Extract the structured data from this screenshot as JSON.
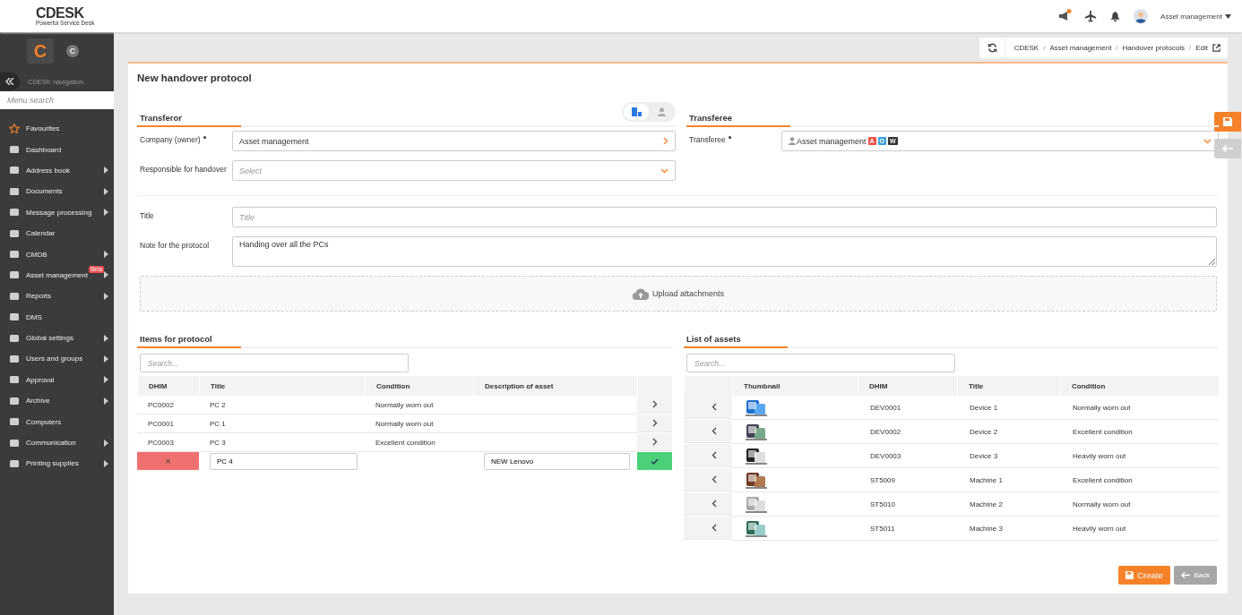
{
  "header": {
    "logo": "CDESK",
    "tagline": "Powerful Service Desk",
    "user": "Asset management"
  },
  "sidebar": {
    "logo_letter": "C",
    "avatar_letter": "C",
    "nav_title": "CDESK navigation",
    "search_placeholder": "Menu search",
    "items": [
      {
        "label": "Favourites",
        "expandable": false
      },
      {
        "label": "Dashboard",
        "expandable": false
      },
      {
        "label": "Address book",
        "expandable": true
      },
      {
        "label": "Documents",
        "expandable": true
      },
      {
        "label": "Message processing",
        "expandable": true
      },
      {
        "label": "Calendar",
        "expandable": false
      },
      {
        "label": "CMDB",
        "expandable": true
      },
      {
        "label": "Asset management",
        "expandable": true,
        "badge": "Beta"
      },
      {
        "label": "Reports",
        "expandable": true
      },
      {
        "label": "DMS",
        "expandable": false
      },
      {
        "label": "Global settings",
        "expandable": true
      },
      {
        "label": "Users and groups",
        "expandable": true
      },
      {
        "label": "Approval",
        "expandable": true
      },
      {
        "label": "Archive",
        "expandable": true
      },
      {
        "label": "Computers",
        "expandable": false
      },
      {
        "label": "Communication",
        "expandable": true
      },
      {
        "label": "Printing supplies",
        "expandable": true
      }
    ]
  },
  "breadcrumbs": [
    {
      "label": "CDESK",
      "separator": "/"
    },
    {
      "label": "Asset management",
      "separator": "/"
    },
    {
      "label": "Handover protocols",
      "separator": "/"
    },
    {
      "label": "Edit"
    }
  ],
  "form": {
    "title": "New handover protocol",
    "transferor": {
      "heading": "Transferor",
      "owner_toggle": [
        {
          "selected": true
        },
        {
          "selected": false
        }
      ],
      "company": {
        "label": "Company (owner)",
        "required": true,
        "value": "Asset management"
      },
      "responsible": {
        "label": "Responsible for handover",
        "required": false,
        "placeholder": "Select"
      }
    },
    "transferee": {
      "heading": "Transferee",
      "label": "Transferee",
      "required": true,
      "value": "Asset management",
      "tags": [
        {
          "text": "A",
          "color": "#f0504a"
        },
        {
          "text": "O",
          "color": "#3aa0d8"
        },
        {
          "text": "W",
          "color": "#333333"
        }
      ]
    },
    "title_field": {
      "label": "Title",
      "placeholder": "Title"
    },
    "note": {
      "label": "Note for the protocol",
      "value": "Handing over all the PCs"
    },
    "upload": {
      "label": "Upload attachments"
    }
  },
  "items": {
    "heading": "Items for protocol",
    "search_placeholder": "Search...",
    "columns": [
      "DHIM",
      "Title",
      "Condition",
      "Description of asset"
    ],
    "rows": [
      {
        "dhim": "PC0002",
        "title": "PC 2",
        "condition": "Normally worn out"
      },
      {
        "dhim": "PC0001",
        "title": "PC 1",
        "condition": "Normally worn out"
      },
      {
        "dhim": "PC0003",
        "title": "PC 3",
        "condition": "Excellent condition"
      }
    ],
    "new_row": {
      "remove": "×",
      "title": "PC 4",
      "description": "NEW Lenovo"
    }
  },
  "assets": {
    "heading": "List of assets",
    "search_placeholder": "Search...",
    "columns": [
      "Thumbnail",
      "DHIM",
      "Title",
      "Condition"
    ],
    "rows": [
      {
        "dhim": "DEV0001",
        "title": "Device 1",
        "condition": "Normally worn out"
      },
      {
        "dhim": "DEV0002",
        "title": "Device 2",
        "condition": "Excellent condition"
      },
      {
        "dhim": "DEV0003",
        "title": "Device 3",
        "condition": "Heavily worn out"
      },
      {
        "dhim": "ST5009",
        "title": "Machine 1",
        "condition": "Excellent condition"
      },
      {
        "dhim": "ST5010",
        "title": "Machine 2",
        "condition": "Normally worn out"
      },
      {
        "dhim": "ST5011",
        "title": "Machine 3",
        "condition": "Heavily worn out"
      }
    ]
  },
  "actions": [
    {
      "label": "Create",
      "kind": "primary",
      "disabled": false
    },
    {
      "label": "Back",
      "kind": "back",
      "disabled": true
    }
  ]
}
